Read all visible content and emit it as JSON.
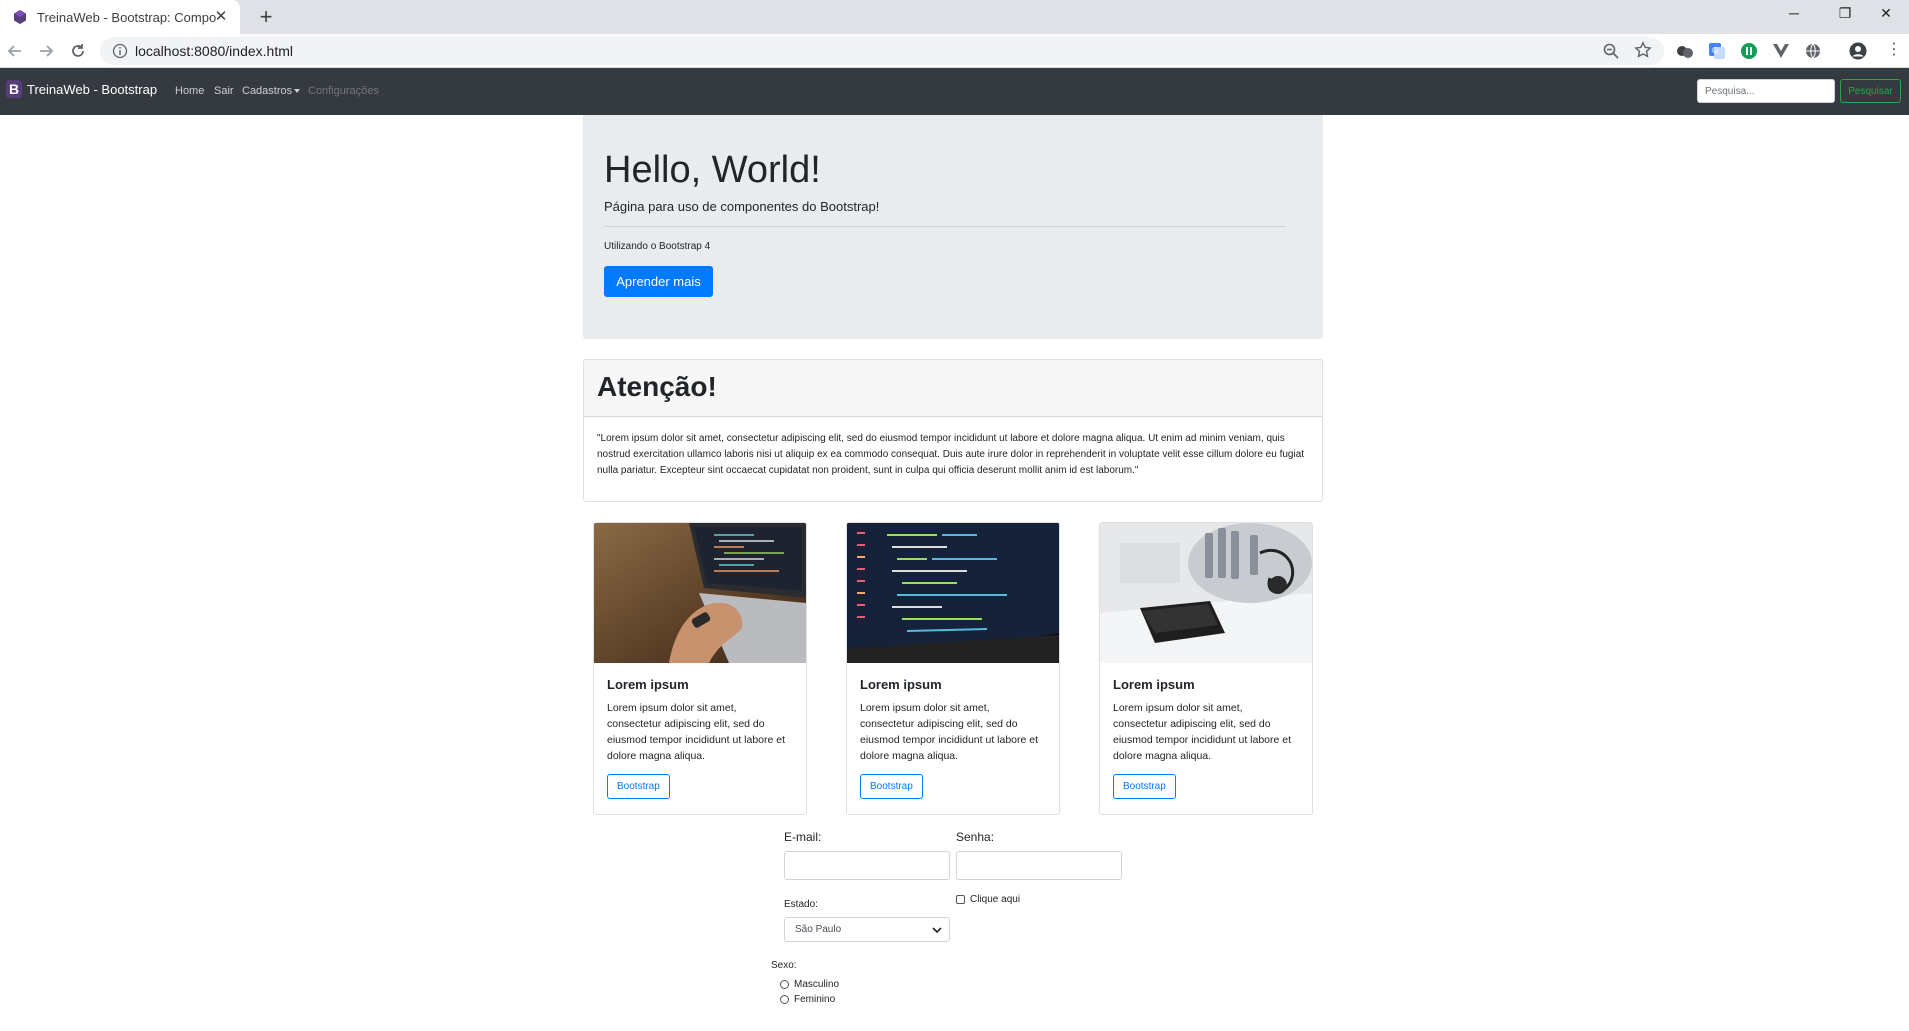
{
  "browser": {
    "tab_title": "TreinaWeb - Bootstrap: Compone",
    "url": "localhost:8080/index.html"
  },
  "navbar": {
    "logo_letter": "B",
    "brand": "TreinaWeb - Bootstrap",
    "links": [
      "Home",
      "Sair",
      "Cadastros",
      "Configurações"
    ],
    "search_placeholder": "Pesquisa...",
    "search_button": "Pesquisar"
  },
  "jumbotron": {
    "title": "Hello, World!",
    "lead": "Página para uso de componentes do Bootstrap!",
    "subtext": "Utilizando o Bootstrap 4",
    "button": "Aprender mais"
  },
  "alert_card": {
    "header": "Atenção!",
    "body": "\"Lorem ipsum dolor sit amet, consectetur adipiscing elit, sed do eiusmod tempor incididunt ut labore et dolore magna aliqua. Ut enim ad minim veniam, quis nostrud exercitation ullamco laboris nisi ut aliquip ex ea commodo consequat. Duis aute irure dolor in reprehenderit in voluptate velit esse cillum dolore eu fugiat nulla pariatur. Excepteur sint occaecat cupidatat non proident, sunt in culpa qui officia deserunt mollit anim id est laborum.\""
  },
  "cards": [
    {
      "title": "Lorem ipsum",
      "text": "Lorem ipsum dolor sit amet, consectetur adipiscing elit, sed do eiusmod tempor incididunt ut labore et dolore magna aliqua.",
      "button": "Bootstrap"
    },
    {
      "title": "Lorem ipsum",
      "text": "Lorem ipsum dolor sit amet, consectetur adipiscing elit, sed do eiusmod tempor incididunt ut labore et dolore magna aliqua.",
      "button": "Bootstrap"
    },
    {
      "title": "Lorem ipsum",
      "text": "Lorem ipsum dolor sit amet, consectetur adipiscing elit, sed do eiusmod tempor incididunt ut labore et dolore magna aliqua.",
      "button": "Bootstrap"
    }
  ],
  "form": {
    "email_label": "E-mail:",
    "email_value": "",
    "senha_label": "Senha:",
    "senha_value": "",
    "checkbox_label": "Clique aqui",
    "estado_label": "Estado:",
    "estado_value": "São Paulo",
    "sexo_label": "Sexo:",
    "sexo_options": [
      "Masculino",
      "Feminino"
    ]
  },
  "colors": {
    "navbar_bg": "#343a40",
    "primary": "#007bff",
    "success": "#28a745",
    "jumbotron_bg": "#e9ecef",
    "bootstrap_purple": "#563d7c"
  }
}
